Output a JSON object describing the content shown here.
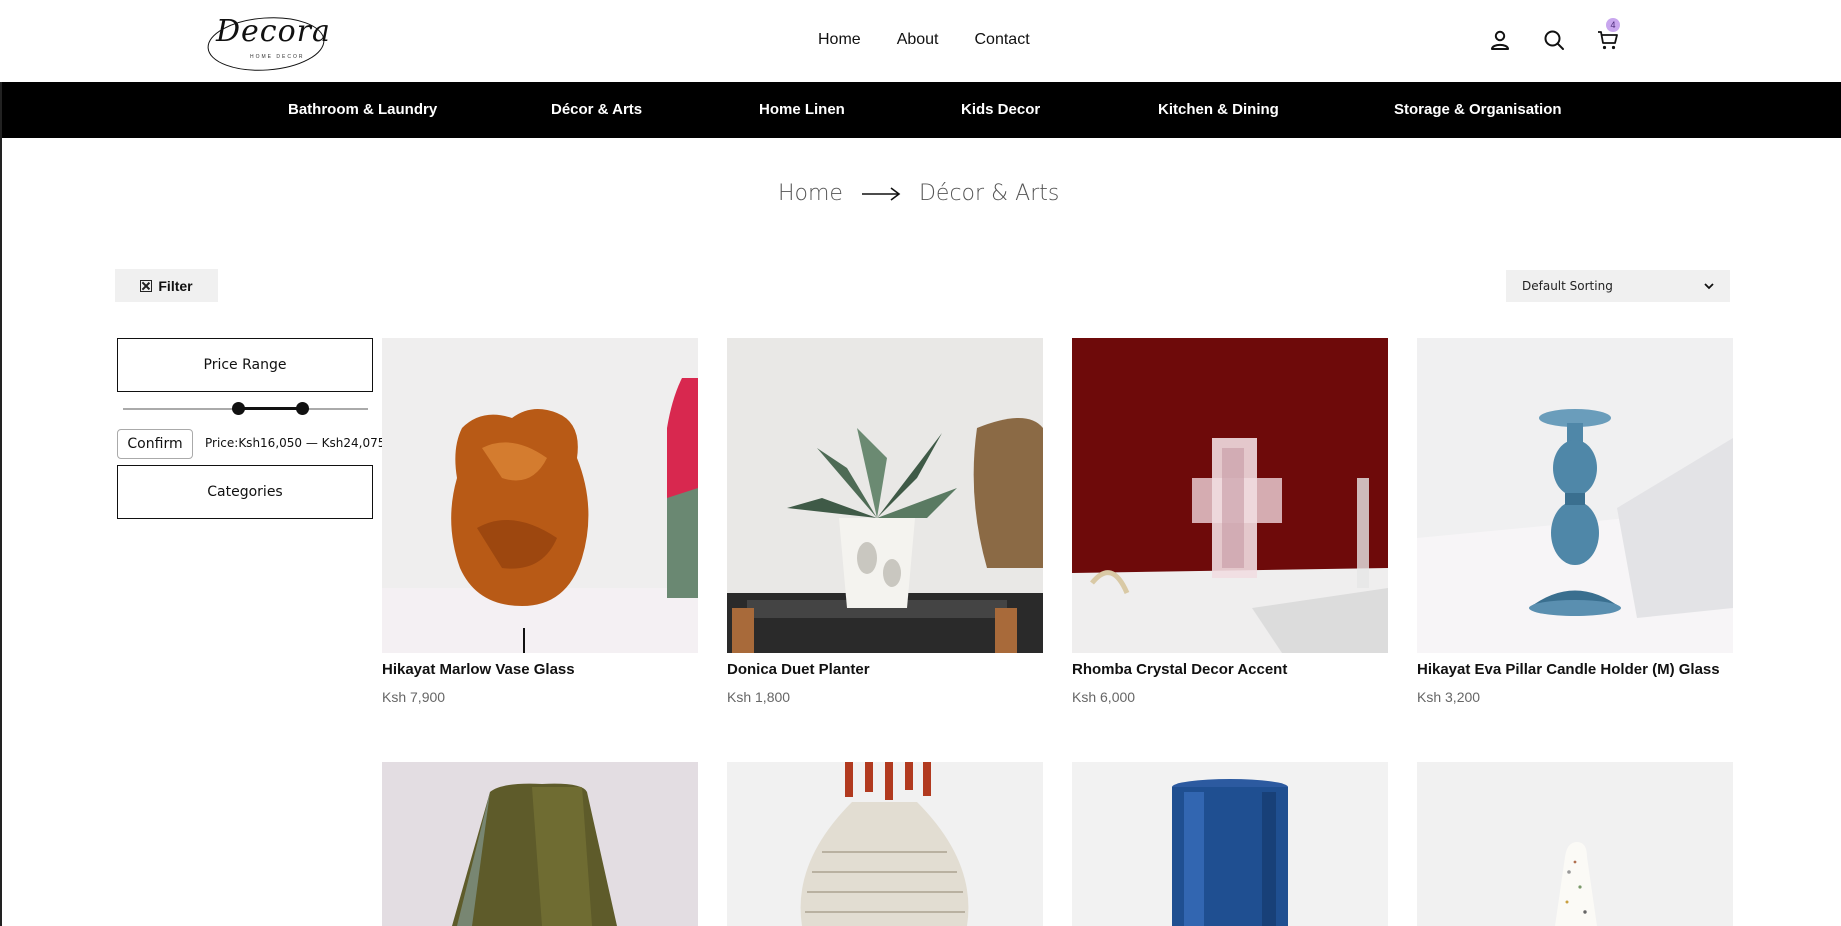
{
  "header": {
    "logo_text": "Decora",
    "logo_sub": "HOME DECOR",
    "nav": [
      "Home",
      "About",
      "Contact"
    ],
    "cart_count": "4"
  },
  "categories": [
    "Bathroom & Laundry",
    "Décor & Arts",
    "Home Linen",
    "Kids Decor",
    "Kitchen & Dining",
    "Storage & Organisation"
  ],
  "breadcrumb": {
    "home": "Home",
    "current": "Décor & Arts"
  },
  "toolbar": {
    "filter_label": "Filter",
    "sort_value": "Default Sorting"
  },
  "sidebar": {
    "price_range_label": "Price Range",
    "confirm_label": "Confirm",
    "price_text": "Price:Ksh16,050 — Ksh24,075",
    "categories_label": "Categories",
    "slider_low_fraction": 0.47,
    "slider_high_fraction": 0.73
  },
  "products": [
    {
      "name": "Hikayat Marlow Vase Glass",
      "price": "Ksh 7,900"
    },
    {
      "name": "Donica Duet Planter",
      "price": "Ksh 1,800"
    },
    {
      "name": "Rhomba Crystal Decor Accent",
      "price": "Ksh 6,000"
    },
    {
      "name": "Hikayat Eva Pillar Candle Holder (M) Glass",
      "price": "Ksh 3,200"
    }
  ],
  "icons": [
    "user-icon",
    "search-icon",
    "cart-icon",
    "arrow-right-icon",
    "close-box-icon",
    "chevron-down-icon"
  ]
}
